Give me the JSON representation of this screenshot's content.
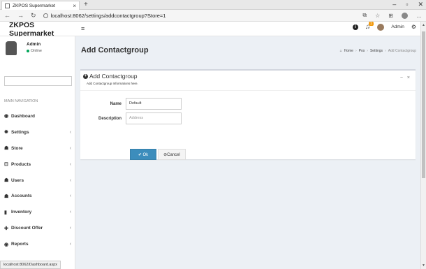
{
  "browser": {
    "tab_title": "ZKPOS Supermarket",
    "tab_close": "×",
    "new_tab": "+",
    "url": "localhost:8062/settings/addcontactgroup?Store=1",
    "status_url": "localhost:8062/Dashboard.aspx"
  },
  "header": {
    "brand": "ZKPOS Supermarket",
    "notification_count": "1",
    "user": "Admin"
  },
  "sidebar": {
    "user_name": "Admin",
    "user_status": "Online",
    "nav_header": "MAIN NAVIGATION",
    "items": [
      {
        "label": "Dashboard",
        "icon": "dashboard-icon",
        "glyph": "◉",
        "chevron": ""
      },
      {
        "label": "Settings",
        "icon": "gear-icon",
        "glyph": "✹",
        "chevron": "‹"
      },
      {
        "label": "Store",
        "icon": "users-icon",
        "glyph": "☗",
        "chevron": "‹"
      },
      {
        "label": "Products",
        "icon": "products-icon",
        "glyph": "⊡",
        "chevron": "‹"
      },
      {
        "label": "Users",
        "icon": "users-icon",
        "glyph": "☗",
        "chevron": "‹"
      },
      {
        "label": "Accounts",
        "icon": "users-icon",
        "glyph": "☗",
        "chevron": "‹"
      },
      {
        "label": "Inventory",
        "icon": "chart-icon",
        "glyph": "▮",
        "chevron": "‹"
      },
      {
        "label": "Discount Offer",
        "icon": "plus-icon",
        "glyph": "✚",
        "chevron": "‹"
      },
      {
        "label": "Reports",
        "icon": "eye-icon",
        "glyph": "◉",
        "chevron": "‹"
      }
    ]
  },
  "page": {
    "title": "Add Contactgroup",
    "breadcrumb": [
      "Home",
      "Pos",
      "Settings",
      "Add Contactgroup"
    ]
  },
  "box": {
    "title": "Add Contactgroup",
    "subtitle": "Add Contactgroup Informations here.",
    "fields": {
      "name_label": "Name",
      "name_value": "Default",
      "description_label": "Description",
      "description_placeholder": "Address"
    },
    "ok_label": "✔ Ok",
    "cancel_label": "⊘Cancel"
  },
  "colors": {
    "primary": "#3c8dbc",
    "online": "#00a65a",
    "badge": "#f39c12",
    "content_bg": "#ecf0f5"
  }
}
